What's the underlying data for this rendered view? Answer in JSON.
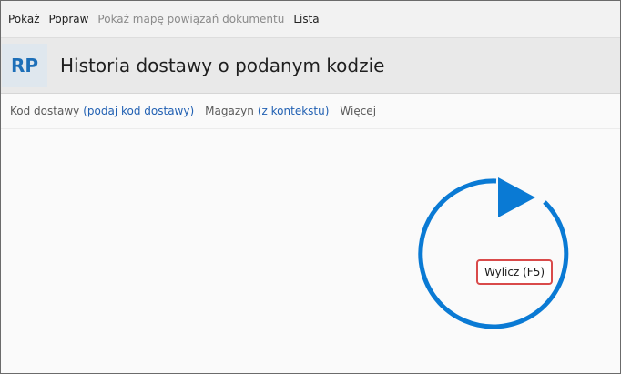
{
  "menu": {
    "items": [
      {
        "label": "Pokaż",
        "enabled": true
      },
      {
        "label": "Popraw",
        "enabled": true
      },
      {
        "label": "Pokaż mapę powiązań dokumentu",
        "enabled": false
      },
      {
        "label": "Lista",
        "enabled": true
      }
    ]
  },
  "header": {
    "badge": "RP",
    "title": "Historia dostawy o podanym kodzie"
  },
  "filters": {
    "delivery_code_label": "Kod dostawy",
    "delivery_code_value": "(podaj kod dostawy)",
    "warehouse_label": "Magazyn",
    "warehouse_value": "(z kontekstu)",
    "more_label": "Więcej"
  },
  "action": {
    "calculate_label": "Wylicz (F5)",
    "icon": "refresh-icon"
  },
  "colors": {
    "accent": "#0a7ad4",
    "link": "#2261b3",
    "highlight_border": "#d94a4a"
  }
}
